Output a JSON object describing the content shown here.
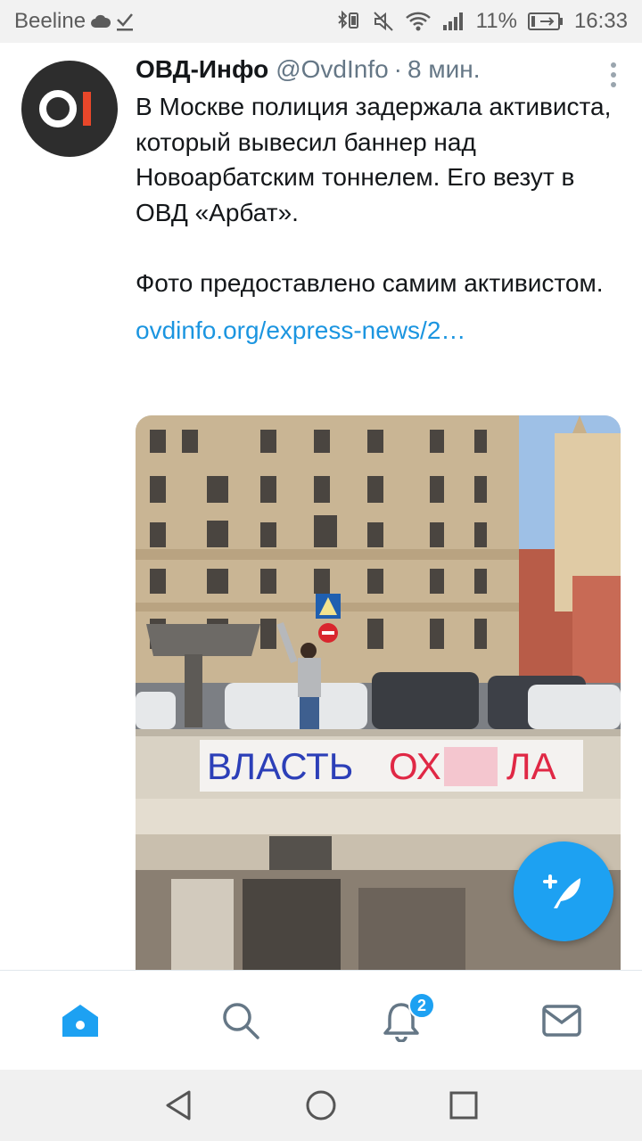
{
  "status_bar": {
    "carrier": "Beeline",
    "battery_percent": "11%",
    "time": "16:33",
    "icons": [
      "cloud-icon",
      "download-check-icon",
      "bluetooth-icon",
      "vibrate-icon",
      "mute-icon",
      "wifi-icon",
      "signal-icon",
      "battery-icon"
    ]
  },
  "tweet": {
    "avatar_text": "OI",
    "author_name": "ОВД-Инфо",
    "author_handle": "@OvdInfo",
    "separator": "·",
    "time": "8 мин.",
    "text": "В Москве полиция задержала активиста, который вывесил баннер над Новоарбатским тоннелем. Его везут в ОВД «Арбат».\n\nФото предоставлено самим активистом.",
    "link": "ovdinfo.org/express-news/2…",
    "photo": {
      "banner_text_blue": "ВЛАСТЬ",
      "banner_text_red_start": "ОХ",
      "banner_text_red_end": "ЛА"
    }
  },
  "bottom_nav": {
    "items": [
      "home",
      "search",
      "notifications",
      "messages"
    ],
    "notifications_badge": "2"
  },
  "colors": {
    "accent": "#1da1f2",
    "link": "#1b95e0",
    "muted": "#657786",
    "avatar_bg": "#2d2d2d",
    "avatar_accent": "#e8472a"
  }
}
